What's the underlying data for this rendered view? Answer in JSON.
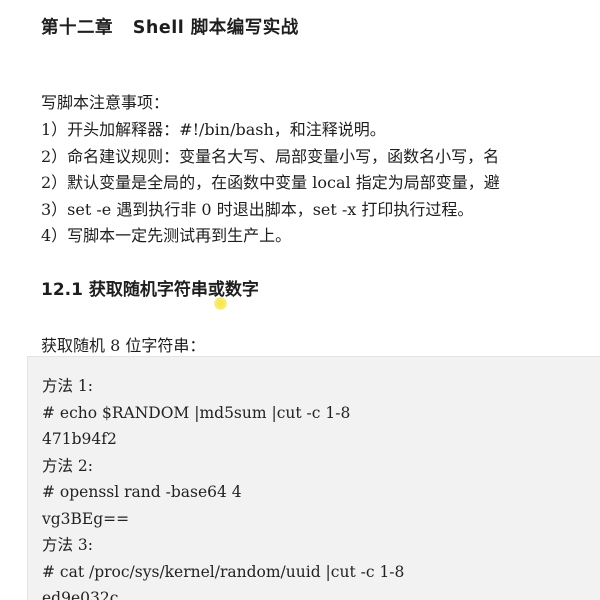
{
  "document": {
    "chapter_title": "第十二章   Shell 脚本编写实战",
    "notes_heading": "写脚本注意事项：",
    "notes": [
      "1）开头加解释器：#!/bin/bash，和注释说明。",
      "2）命名建议规则：变量名大写、局部变量小写，函数名小写，名",
      "2）默认变量是全局的，在函数中变量 local 指定为局部变量，避",
      "3）set -e 遇到执行非 0 时退出脚本，set -x 打印执行过程。",
      "4）写脚本一定先测试再到生产上。"
    ],
    "section_title": "12.1 获取随机字符串或数字",
    "intro": "获取随机 8 位字符串：",
    "code_lines": [
      "方法 1:",
      "# echo $RANDOM |md5sum |cut -c 1-8",
      "471b94f2",
      "方法 2:",
      "# openssl rand -base64 4",
      "vg3BEg==",
      "方法 3:",
      "# cat /proc/sys/kernel/random/uuid |cut -c 1-8",
      "ed9e032c"
    ]
  }
}
